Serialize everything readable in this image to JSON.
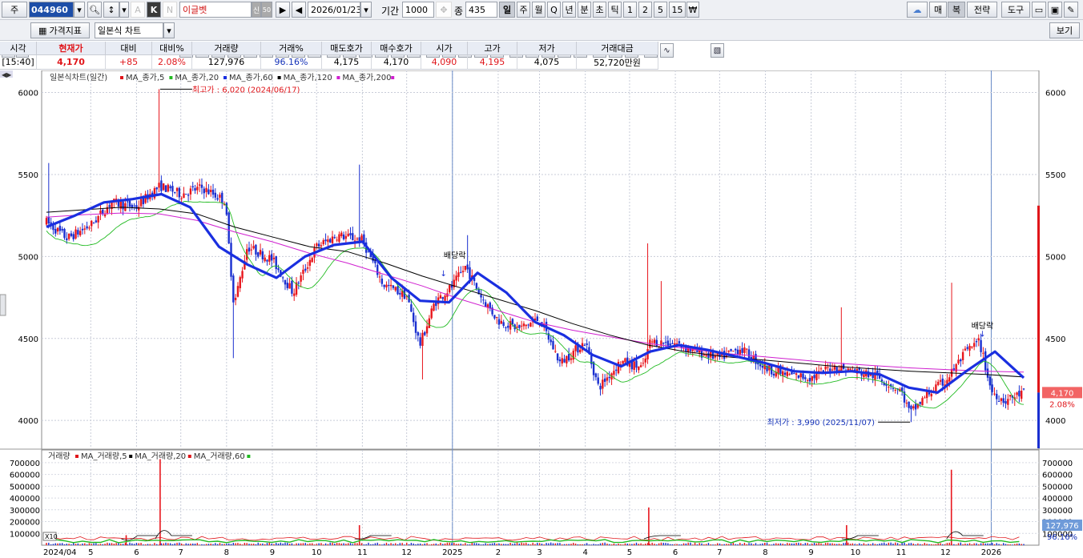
{
  "toolbar": {
    "market_label": "주",
    "stock_code": "044960",
    "stock_name": "이글벳",
    "sin_label": "신",
    "date": "2026/01/23",
    "period_label": "기간",
    "period_value": "1000",
    "count_label": "종",
    "count_value": "435",
    "periods": [
      "일",
      "주",
      "월",
      "Q",
      "년",
      "분",
      "초",
      "틱",
      "1",
      "2",
      "5",
      "15"
    ],
    "currency_icon": "₩",
    "right_buttons": {
      "mae": "매",
      "bok": "복",
      "strategy": "전략",
      "tools": "도구"
    },
    "k_label": "K",
    "n_label": "N",
    "a_label": "A"
  },
  "toolbar2": {
    "price_indicator": "가격지표",
    "chart_type": "일본식 차트",
    "view": "보기"
  },
  "quote": {
    "headers": [
      "시각",
      "현재가",
      "대비",
      "대비%",
      "거래량",
      "거래%",
      "매도호가",
      "매수호가",
      "시가",
      "고가",
      "저가",
      "거래대금"
    ],
    "values": [
      "[15:40]",
      "4,170",
      "+85",
      "2.08%",
      "127,976",
      "96.16%",
      "4,175",
      "4,170",
      "4,090",
      "4,195",
      "4,075",
      "52,720만원"
    ]
  },
  "chart_data": {
    "type": "candlestick",
    "title": "일본식차트(일간)",
    "legend": [
      {
        "name": "MA_종가,5",
        "color": "#e0151a"
      },
      {
        "name": "MA_종가,20",
        "color": "#22bb22"
      },
      {
        "name": "MA_종가,60",
        "color": "#1a2fe0"
      },
      {
        "name": "MA_종가,120",
        "color": "#000000"
      },
      {
        "name": "MA_종가,200",
        "color": "#d020d0"
      }
    ],
    "y_ticks": [
      4000,
      4500,
      5000,
      5500,
      6000
    ],
    "ylim": [
      3830,
      6110
    ],
    "x_labels": [
      "2024/04",
      "5",
      "6",
      "7",
      "8",
      "9",
      "10",
      "11",
      "12",
      "2025",
      "2",
      "3",
      "4",
      "5",
      "6",
      "7",
      "8",
      "9",
      "10",
      "11",
      "12",
      "2026"
    ],
    "close_path": [
      {
        "date": "2024-04-01",
        "close": 5210
      },
      {
        "date": "2024-04-15",
        "close": 5110
      },
      {
        "date": "2024-05-01",
        "close": 5190
      },
      {
        "date": "2024-05-15",
        "close": 5330
      },
      {
        "date": "2024-06-01",
        "close": 5300
      },
      {
        "date": "2024-06-10",
        "close": 5380
      },
      {
        "date": "2024-06-17",
        "close": 5430
      },
      {
        "date": "2024-07-01",
        "close": 5380
      },
      {
        "date": "2024-07-15",
        "close": 5420
      },
      {
        "date": "2024-07-31",
        "close": 5340
      },
      {
        "date": "2024-08-06",
        "close": 4700
      },
      {
        "date": "2024-08-15",
        "close": 5060
      },
      {
        "date": "2024-09-01",
        "close": 4980
      },
      {
        "date": "2024-09-15",
        "close": 4780
      },
      {
        "date": "2024-10-01",
        "close": 5060
      },
      {
        "date": "2024-10-15",
        "close": 5130
      },
      {
        "date": "2024-11-01",
        "close": 5100
      },
      {
        "date": "2024-11-15",
        "close": 4830
      },
      {
        "date": "2024-12-01",
        "close": 4760
      },
      {
        "date": "2024-12-10",
        "close": 4460
      },
      {
        "date": "2024-12-20",
        "close": 4720
      },
      {
        "date": "2025-01-01",
        "close": 4820
      },
      {
        "date": "2025-01-10",
        "close": 4940
      },
      {
        "date": "2025-01-20",
        "close": 4760
      },
      {
        "date": "2025-02-01",
        "close": 4610
      },
      {
        "date": "2025-02-15",
        "close": 4560
      },
      {
        "date": "2025-03-01",
        "close": 4620
      },
      {
        "date": "2025-03-15",
        "close": 4350
      },
      {
        "date": "2025-04-01",
        "close": 4480
      },
      {
        "date": "2025-04-10",
        "close": 4200
      },
      {
        "date": "2025-04-25",
        "close": 4360
      },
      {
        "date": "2025-05-10",
        "close": 4320
      },
      {
        "date": "2025-05-15",
        "close": 4480
      },
      {
        "date": "2025-06-01",
        "close": 4470
      },
      {
        "date": "2025-06-15",
        "close": 4420
      },
      {
        "date": "2025-07-01",
        "close": 4380
      },
      {
        "date": "2025-07-15",
        "close": 4440
      },
      {
        "date": "2025-08-01",
        "close": 4320
      },
      {
        "date": "2025-08-15",
        "close": 4280
      },
      {
        "date": "2025-09-01",
        "close": 4260
      },
      {
        "date": "2025-09-15",
        "close": 4330
      },
      {
        "date": "2025-10-01",
        "close": 4300
      },
      {
        "date": "2025-10-15",
        "close": 4270
      },
      {
        "date": "2025-11-01",
        "close": 4180
      },
      {
        "date": "2025-11-07",
        "close": 4040
      },
      {
        "date": "2025-11-20",
        "close": 4170
      },
      {
        "date": "2025-12-01",
        "close": 4240
      },
      {
        "date": "2025-12-15",
        "close": 4420
      },
      {
        "date": "2025-12-24",
        "close": 4480
      },
      {
        "date": "2026-01-01",
        "close": 4180
      },
      {
        "date": "2026-01-10",
        "close": 4120
      },
      {
        "date": "2026-01-23",
        "close": 4170
      }
    ],
    "ma_paths": {
      "ma60": [
        5180,
        5250,
        5330,
        5350,
        5380,
        5300,
        5060,
        4950,
        4870,
        5000,
        5070,
        5090,
        4870,
        4730,
        4720,
        4900,
        4780,
        4600,
        4520,
        4400,
        4330,
        4420,
        4460,
        4430,
        4390,
        4350,
        4300,
        4290,
        4300,
        4280,
        4200,
        4170,
        4300,
        4420,
        4260
      ],
      "ma120": [
        5270,
        5285,
        5300,
        5290,
        5260,
        5180,
        5120,
        5060,
        5030,
        4960,
        4880,
        4810,
        4740,
        4670,
        4590,
        4520,
        4460,
        4420,
        4390,
        4370,
        4350,
        4330,
        4315,
        4300,
        4290,
        4280,
        4265
      ],
      "ma200": [
        5240,
        5255,
        5265,
        5260,
        5220,
        5150,
        5090,
        5020,
        4960,
        4890,
        4820,
        4740,
        4670,
        4600,
        4550,
        4510,
        4470,
        4440,
        4410,
        4390,
        4370,
        4350,
        4335,
        4320,
        4310,
        4300,
        4295
      ]
    },
    "annotations": {
      "high": "최고가 : 6,020 (2024/06/17)",
      "low": "최저가 : 3,990 (2025/11/07)",
      "dividend1": "배당락",
      "dividend2": "배당락",
      "last_price": "4,170",
      "last_pct": "2.08%"
    },
    "volume": {
      "title": "거래량",
      "legend": [
        {
          "name": "MA_거래량,5",
          "color": "#e0151a"
        },
        {
          "name": "MA_거래량,20",
          "color": "#000000"
        },
        {
          "name": "MA_거래량,60",
          "color": "#e0151a"
        },
        {
          "name": "",
          "color": "#22bb22"
        }
      ],
      "y_ticks": [
        100000,
        200000,
        300000,
        400000,
        500000,
        600000,
        700000
      ],
      "ylim": [
        0,
        740000
      ],
      "spikes": [
        {
          "date": "2024-06-17",
          "volume": 730000
        },
        {
          "date": "2024-05-25",
          "volume": 85000
        },
        {
          "date": "2024-10-30",
          "volume": 170000
        },
        {
          "date": "2025-05-14",
          "volume": 320000
        },
        {
          "date": "2025-09-25",
          "volume": 170000
        },
        {
          "date": "2025-12-05",
          "volume": 640000
        }
      ],
      "last_volume": "127,976",
      "last_pct": "96.16%",
      "scale_label": "X10"
    }
  }
}
